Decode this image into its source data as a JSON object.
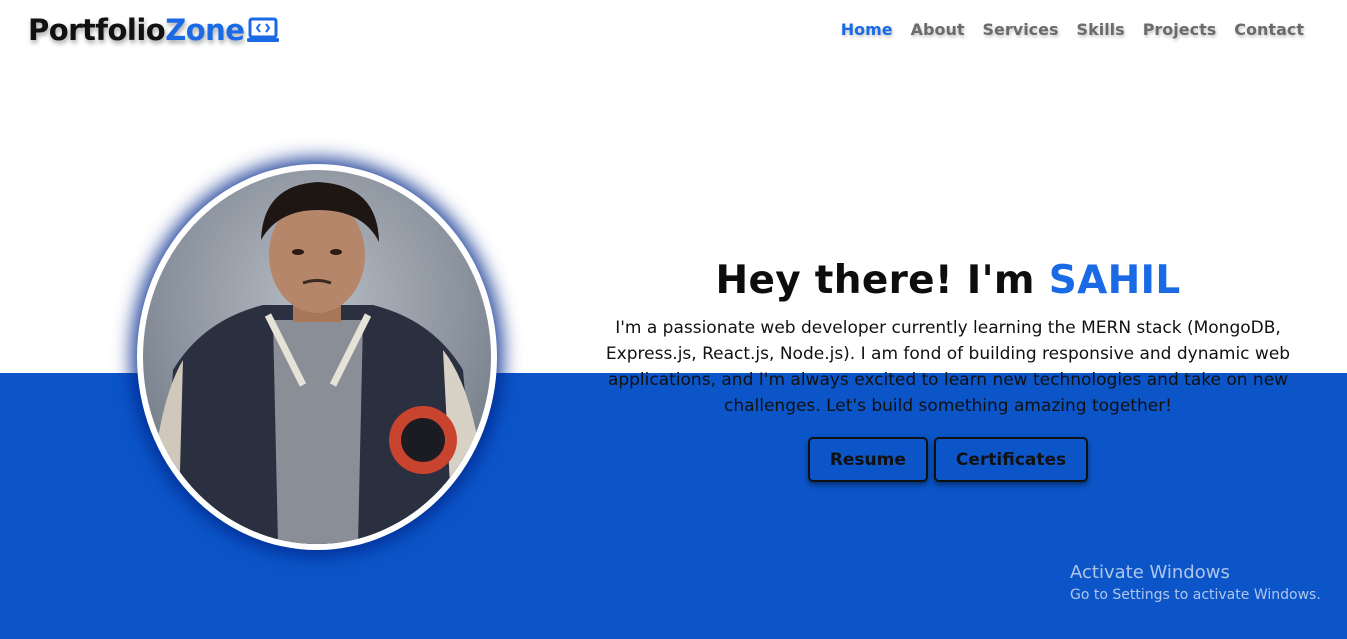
{
  "logo": {
    "main": "Portfolio",
    "accent": "Zone",
    "icon": "laptop-code-icon"
  },
  "nav": {
    "items": [
      {
        "label": "Home",
        "active": true
      },
      {
        "label": "About",
        "active": false
      },
      {
        "label": "Services",
        "active": false
      },
      {
        "label": "Skills",
        "active": false
      },
      {
        "label": "Projects",
        "active": false
      },
      {
        "label": "Contact",
        "active": false
      }
    ]
  },
  "hero": {
    "greeting": "Hey there! I'm",
    "name": "SAHIL",
    "description": "I'm a passionate web developer currently learning the MERN stack (MongoDB, Express.js, React.js, Node.js). I am fond of building responsive and dynamic web applications, and I'm always excited to learn new technologies and take on new challenges. Let's build something amazing together!",
    "buttons": {
      "resume": "Resume",
      "certificates": "Certificates"
    }
  },
  "watermark": {
    "title": "Activate Windows",
    "subtitle": "Go to Settings to activate Windows."
  },
  "colors": {
    "accent": "#1a6ae6",
    "section_bg": "#0b55c9",
    "text": "#111111",
    "nav_text": "#6b6b6b"
  }
}
